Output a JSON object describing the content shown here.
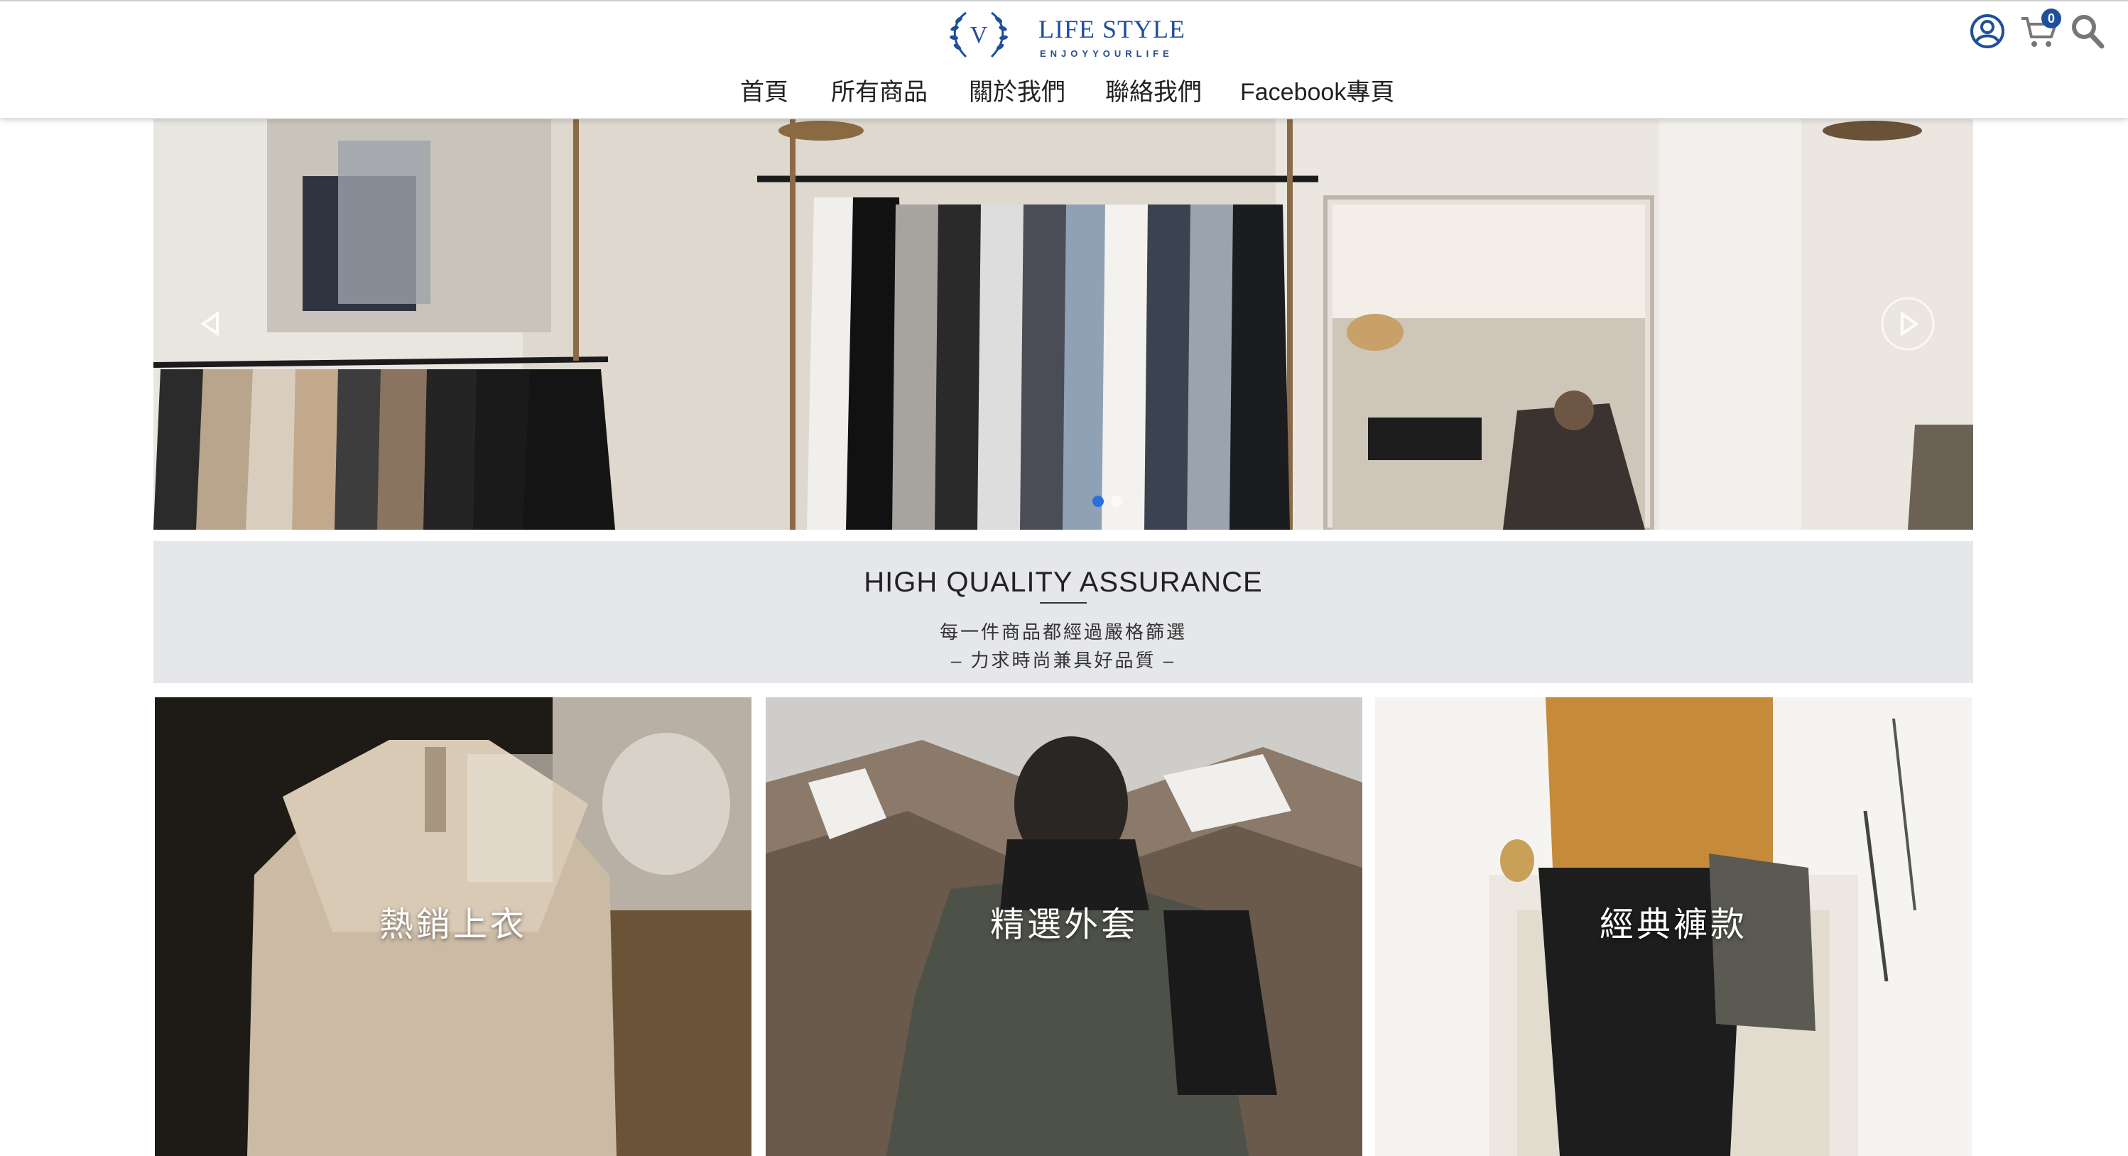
{
  "brand": {
    "title": "LIFE STYLE",
    "tagline": "ENJOYYOURLIFE",
    "emblem_letter": "V",
    "color": "#1f4f9a"
  },
  "nav": {
    "items": [
      {
        "label": "首頁"
      },
      {
        "label": "所有商品"
      },
      {
        "label": "關於我們"
      },
      {
        "label": "聯絡我們"
      },
      {
        "label": "Facebook專頁"
      }
    ]
  },
  "header_icons": {
    "account": "user-circle-icon",
    "cart": "cart-icon",
    "cart_count": "0",
    "search": "search-icon"
  },
  "hero": {
    "slide_count": 2,
    "active_slide": 0,
    "prev_icon": "triangle-left-icon",
    "next_icon": "triangle-right-icon",
    "dot_active_color": "#2a6fdb"
  },
  "quality_banner": {
    "title": "HIGH QUALITY ASSURANCE",
    "line1": "每一件商品都經過嚴格篩選",
    "line2": "– 力求時尚兼具好品質 –"
  },
  "categories": [
    {
      "label": "熱銷上衣"
    },
    {
      "label": "精選外套"
    },
    {
      "label": "經典褲款"
    }
  ]
}
